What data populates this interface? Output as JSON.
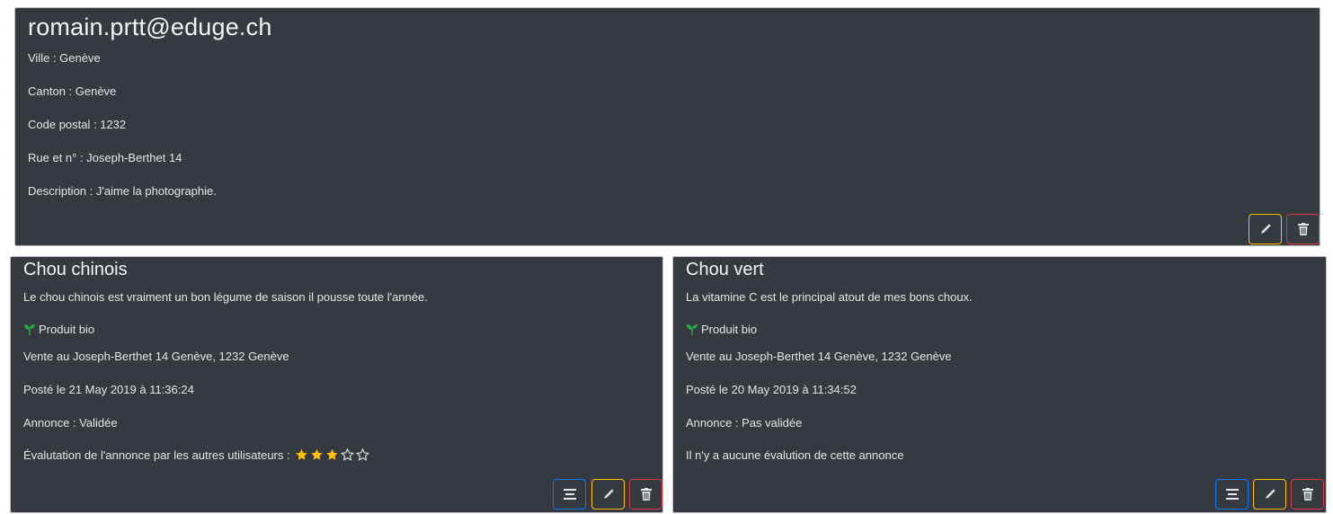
{
  "profile": {
    "email": "romain.prtt@eduge.ch",
    "ville": "Ville : Genève",
    "canton": "Canton : Genève",
    "code_postal": "Code postal : 1232",
    "rue": "Rue et n° : Joseph-Berthet 14",
    "description": "Description : J'aime la photographie."
  },
  "listings": [
    {
      "title": "Chou chinois",
      "description": "Le chou chinois est vraiment un bon légume de saison il pousse toute l'année.",
      "bio_label": "Produit bio",
      "location": "Vente au Joseph-Berthet 14 Genève, 1232 Genève",
      "posted": "Posté le 21 May 2019 à 11:36:24",
      "status": "Annonce : Validée",
      "rating_label": "Évalutation de l'annonce par les autres utilisateurs :",
      "rating": 3,
      "rating_max": 5
    },
    {
      "title": "Chou vert",
      "description": "La vitamine C est le principal atout de mes bons choux.",
      "bio_label": "Produit bio",
      "location": "Vente au Joseph-Berthet 14 Genève, 1232 Genève",
      "posted": "Posté le 20 May 2019 à 11:34:52",
      "status": "Annonce : Pas validée",
      "rating_text": "Il n'y a aucune évalution de cette annonce"
    }
  ],
  "icons": {
    "edit": "pencil-icon",
    "delete": "trash-icon",
    "details": "list-icon",
    "bio": "sprout-icon",
    "star_filled": "star-filled-icon",
    "star_empty": "star-outline-icon"
  },
  "colors": {
    "card_bg": "#343a40",
    "warning": "#ffc107",
    "danger": "#dc3545",
    "primary": "#007bff",
    "bio_green": "#28a745",
    "star": "#ffc107"
  }
}
